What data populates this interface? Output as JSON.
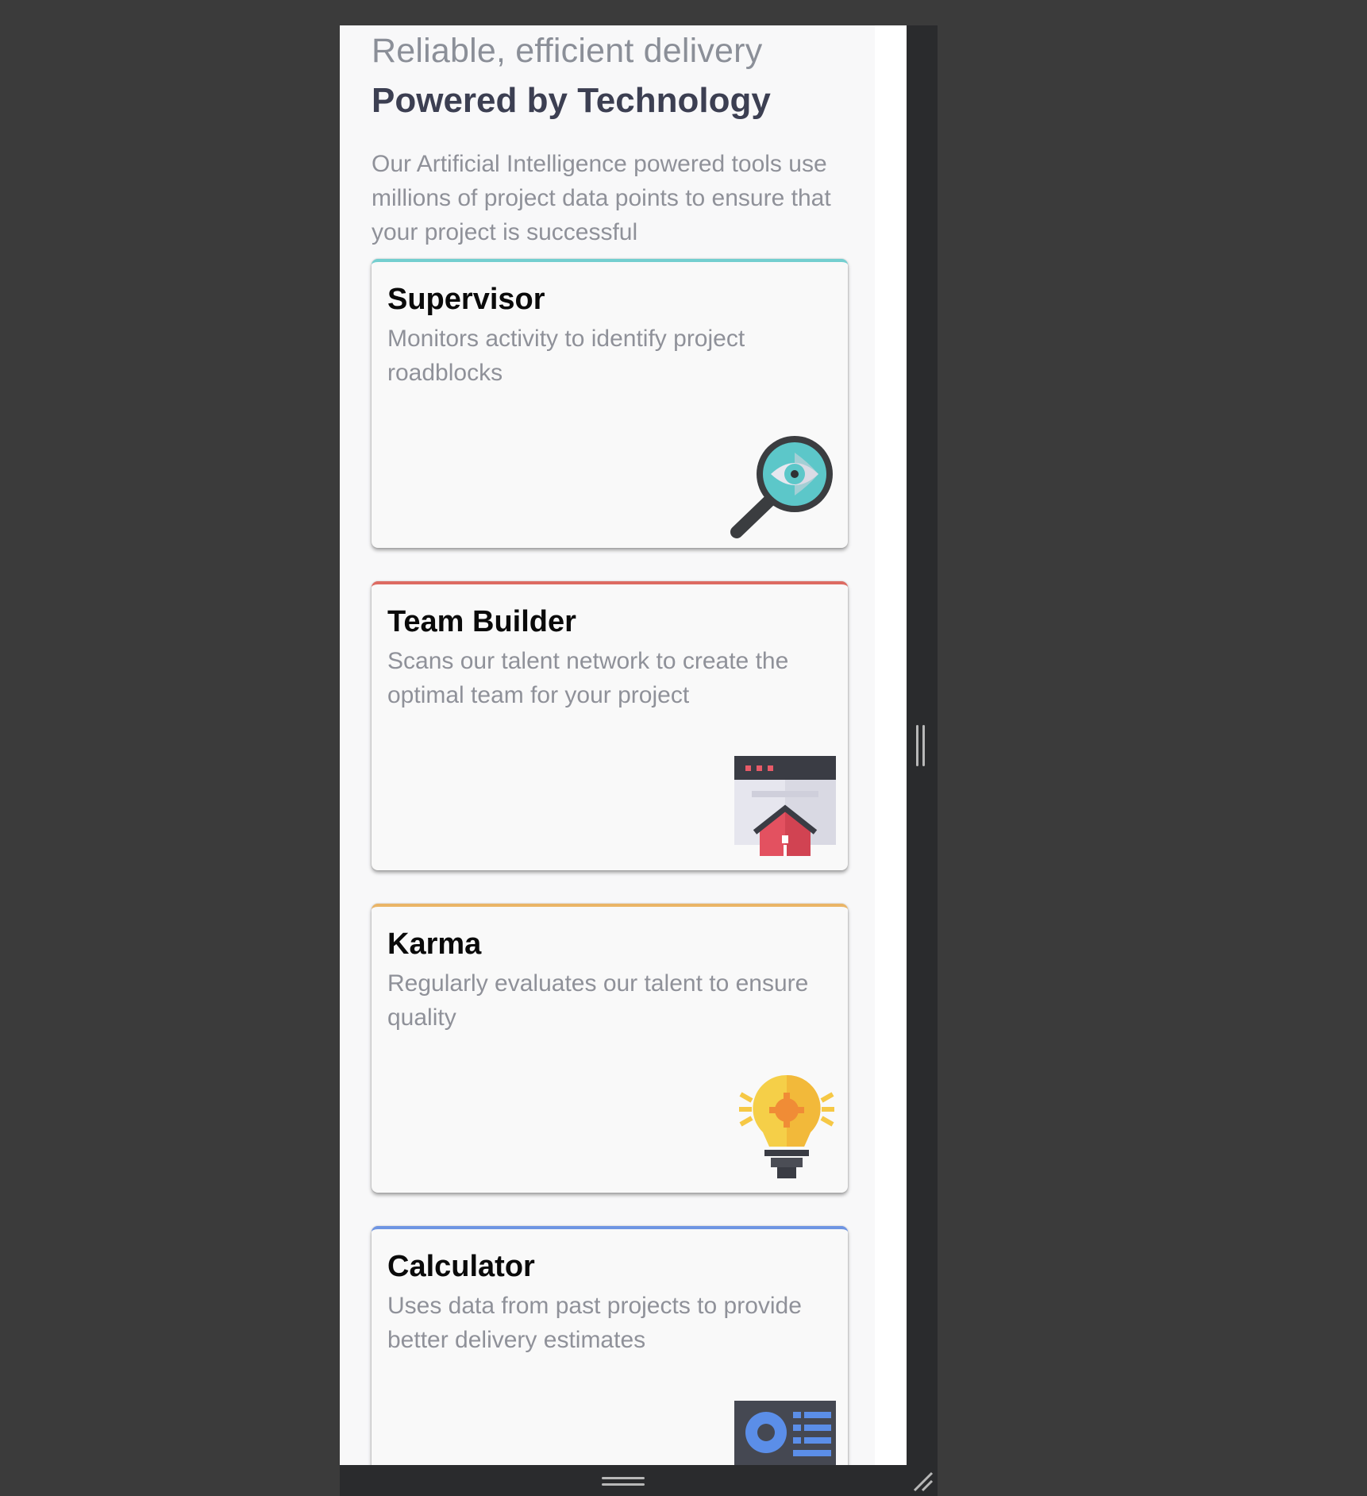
{
  "section": {
    "eyebrow": "Reliable, efficient delivery",
    "headline": "Powered by Technology",
    "intro": "Our Artificial Intelligence powered tools use millions of project data points to ensure that your project is successful"
  },
  "cards": [
    {
      "title": "Supervisor",
      "description": "Monitors activity to identify project roadblocks",
      "accent": "#74cfd0",
      "icon": "magnifier-eye-icon"
    },
    {
      "title": "Team Builder",
      "description": "Scans our talent network to create the optimal team for your project",
      "accent": "#dd6b62",
      "icon": "browser-house-icon"
    },
    {
      "title": "Karma",
      "description": "Regularly evaluates our talent to ensure quality",
      "accent": "#eab567",
      "icon": "lightbulb-gear-icon"
    },
    {
      "title": "Calculator",
      "description": "Uses data from past projects to provide better delivery estimates",
      "accent": "#6f95e3",
      "icon": "dashboard-list-icon"
    }
  ]
}
